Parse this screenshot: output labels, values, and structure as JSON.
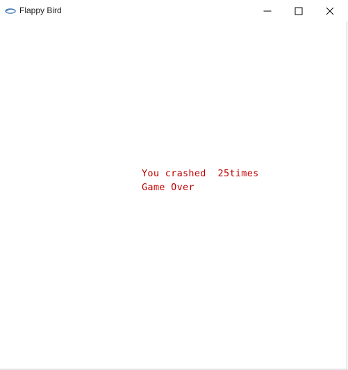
{
  "window": {
    "title": "Flappy Bird",
    "icon": "app-bird-icon",
    "controls": [
      "minimize-icon",
      "maximize-icon",
      "close-icon"
    ]
  },
  "game": {
    "crash_message": "You crashed  25times",
    "game_over": "Game Over",
    "text_color": "#c00000"
  }
}
